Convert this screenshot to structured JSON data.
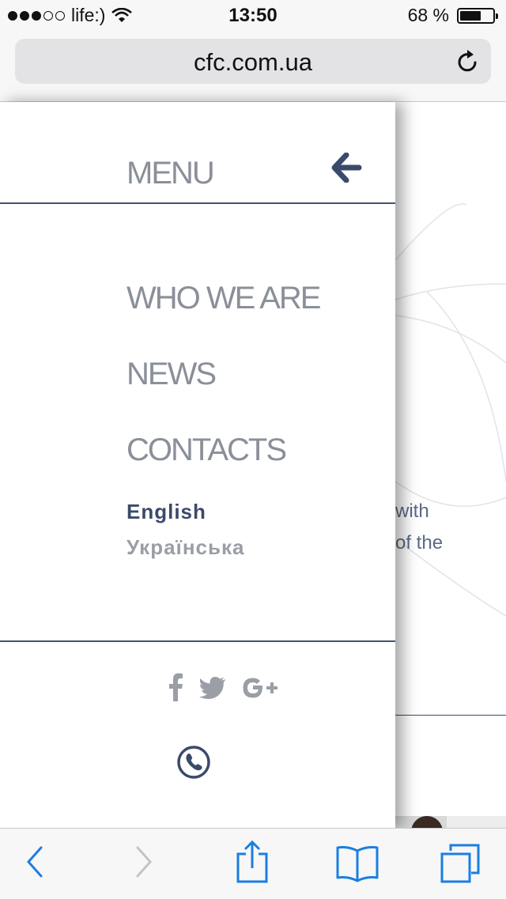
{
  "status_bar": {
    "carrier": "life:)",
    "time": "13:50",
    "battery_percent": "68 %",
    "battery_level": 0.68,
    "signal_bars_filled": 3,
    "signal_bars_total": 5
  },
  "browser": {
    "url": "cfc.com.ua",
    "reload_icon": "reload-icon"
  },
  "menu": {
    "title": "MENU",
    "back_icon": "arrow-left-icon",
    "items": [
      {
        "label": "WHO WE ARE"
      },
      {
        "label": "NEWS"
      },
      {
        "label": "CONTACTS"
      }
    ],
    "languages": [
      {
        "label": "English",
        "active": true
      },
      {
        "label": "Українська",
        "active": false
      }
    ],
    "social_icons": [
      "facebook-icon",
      "twitter-icon",
      "google-plus-icon"
    ],
    "phone_icon": "phone-icon"
  },
  "background_page": {
    "text_line_1": "with",
    "text_line_2": "of the"
  },
  "toolbar": {
    "icons": [
      "back-icon",
      "forward-icon",
      "share-icon",
      "bookmarks-icon",
      "tabs-icon"
    ]
  },
  "colors": {
    "accent": "#3b4a6b",
    "menu_text": "#8a8f99",
    "ios_blue": "#1a7fe0"
  }
}
